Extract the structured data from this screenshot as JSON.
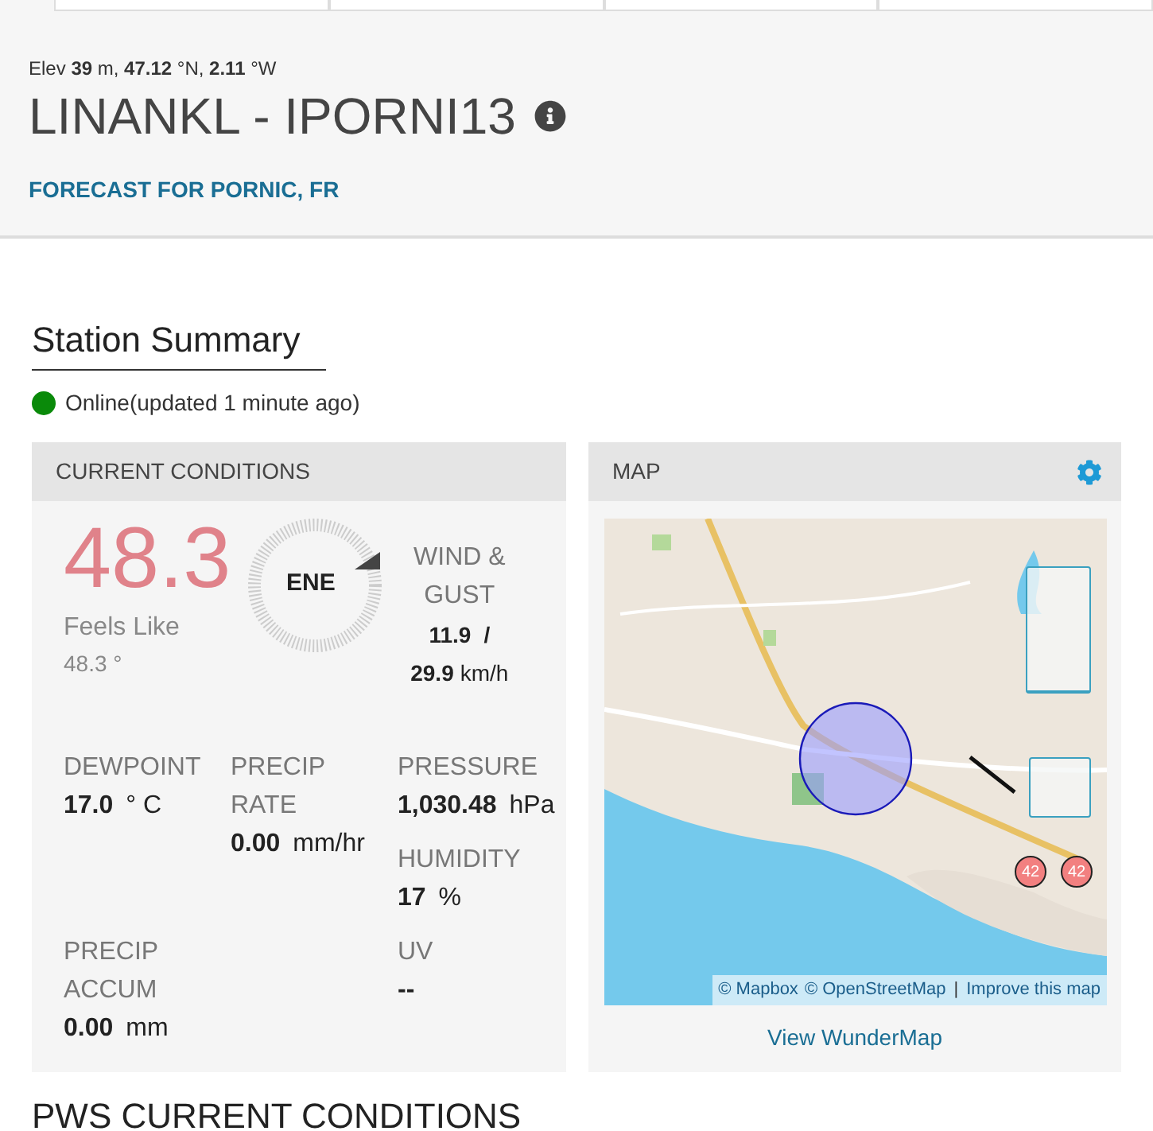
{
  "header": {
    "location_line": "Elev **39** m, **47.12** °N, **2.11** °W",
    "title": "LINANKL - IPORNI13",
    "forecast_link": "FORECAST FOR PORNIC, FR"
  },
  "summary": {
    "heading": "Station Summary",
    "status": {
      "text": "Online(updated 1 minute ago)",
      "online": true
    }
  },
  "current_conditions": {
    "title": "CURRENT CONDITIONS",
    "temperature": "48.3",
    "feels_like_label": "Feels Like",
    "feels_like": "48.3 °",
    "wind_direction": "ENE",
    "wind_label": "WIND & GUST",
    "wind_speed": "11.9",
    "wind_separator": "/",
    "wind_gust": "29.9",
    "wind_unit": "km/h",
    "metric_rows": [
      [
        [
          {
            "label": "DEWPOINT",
            "value": "17.0",
            "unit": "° C"
          }
        ],
        [
          {
            "label": "PRECIP RATE",
            "value": "0.00",
            "unit": "mm/hr"
          }
        ],
        [
          {
            "label": "PRESSURE",
            "value": "1,030.48",
            "unit": "hPa"
          },
          {
            "label": "HUMIDITY",
            "value": "17",
            "unit": "%"
          }
        ]
      ],
      [
        [
          {
            "label": "PRECIP ACCUM",
            "value": "0.00",
            "unit": "mm"
          }
        ],
        [
          {
            "label": "UV",
            "value": "--"
          }
        ]
      ]
    ]
  },
  "map": {
    "title": "MAP",
    "markers": [
      "42",
      "42"
    ],
    "attribution": [
      {
        "text": "© Mapbox"
      },
      {
        "text": "© OpenStreetMap"
      },
      {
        "text": "|"
      },
      {
        "text": "Improve this map"
      }
    ],
    "link": "View WunderMap"
  },
  "next_section": {
    "heading": "PWS CURRENT CONDITIONS"
  }
}
